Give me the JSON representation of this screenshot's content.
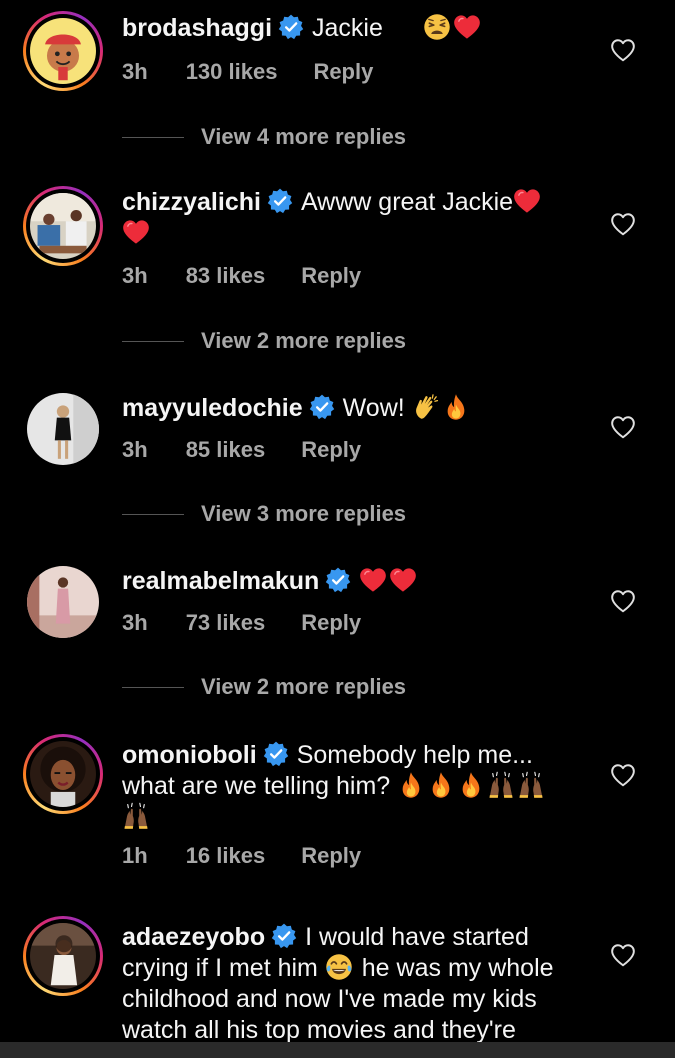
{
  "comments": [
    {
      "username": "brodashaggi",
      "verified": true,
      "text_parts": [
        "Jackie"
      ],
      "emojis": [
        "tired-face-emoji",
        "red-heart-emoji"
      ],
      "time": "3h",
      "likes": "130 likes",
      "reply": "Reply",
      "view_replies": "View 4 more replies"
    },
    {
      "username": "chizzyalichi",
      "verified": true,
      "text_parts": [
        "Awww great Jackie"
      ],
      "emojis": [
        "red-heart-emoji",
        "red-heart-emoji"
      ],
      "time": "3h",
      "likes": "83 likes",
      "reply": "Reply",
      "view_replies": "View 2 more replies"
    },
    {
      "username": "mayyuledochie",
      "verified": true,
      "text_parts": [
        "Wow!"
      ],
      "emojis": [
        "clapping-hands-emoji",
        "fire-emoji"
      ],
      "time": "3h",
      "likes": "85 likes",
      "reply": "Reply",
      "view_replies": "View 3 more replies"
    },
    {
      "username": "realmabelmakun",
      "verified": true,
      "text_parts": [],
      "emojis": [
        "red-heart-emoji",
        "red-heart-emoji"
      ],
      "time": "3h",
      "likes": "73 likes",
      "reply": "Reply",
      "view_replies": "View 2 more replies"
    },
    {
      "username": "omonioboli",
      "verified": true,
      "text_line1": "Somebody help me...",
      "text_line2": "what are we telling him?",
      "emojis": [
        "fire-emoji",
        "fire-emoji",
        "fire-emoji",
        "raising-hands-emoji",
        "raising-hands-emoji",
        "raising-hands-emoji"
      ],
      "time": "1h",
      "likes": "16 likes",
      "reply": "Reply"
    },
    {
      "username": "adaezeyobo",
      "verified": true,
      "text_line1": "I would have started",
      "text_line2": "crying if I met him",
      "text_line2b": "he was my whole",
      "text_line3": "childhood and now I've made my kids",
      "text_line4": "watch all his top movies and they're",
      "emojis": [
        "face-with-tears-of-joy-emoji"
      ]
    }
  ],
  "colors": {
    "background": "#000000",
    "text": "#f5f5f5",
    "meta": "#a8a8a8",
    "verified_blue": "#3897f0",
    "heart_red": "#ed2c3a"
  }
}
